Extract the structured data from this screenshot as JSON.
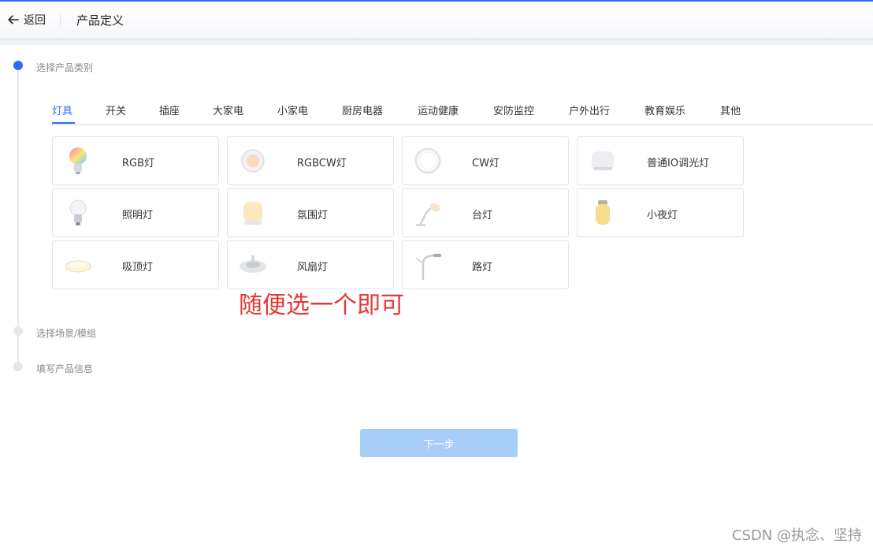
{
  "header": {
    "back_label": "返回",
    "title": "产品定义"
  },
  "steps": [
    {
      "label": "选择产品类别",
      "active": true
    },
    {
      "label": "选择场景/模组",
      "active": false
    },
    {
      "label": "填写产品信息",
      "active": false
    }
  ],
  "tabs": [
    {
      "label": "灯具",
      "active": true
    },
    {
      "label": "开关"
    },
    {
      "label": "插座"
    },
    {
      "label": "大家电"
    },
    {
      "label": "小家电"
    },
    {
      "label": "厨房电器"
    },
    {
      "label": "运动健康"
    },
    {
      "label": "安防监控"
    },
    {
      "label": "户外出行"
    },
    {
      "label": "教育娱乐"
    },
    {
      "label": "其他"
    }
  ],
  "products": [
    {
      "label": "RGB灯",
      "icon": "rgb-bulb-icon"
    },
    {
      "label": "RGBCW灯",
      "icon": "rgbcw-downlight-icon"
    },
    {
      "label": "CW灯",
      "icon": "cw-ring-light-icon"
    },
    {
      "label": "普通IO调光灯",
      "icon": "io-dimmer-light-icon"
    },
    {
      "label": "照明灯",
      "icon": "lighting-bulb-icon"
    },
    {
      "label": "氛围灯",
      "icon": "ambient-lamp-icon"
    },
    {
      "label": "台灯",
      "icon": "desk-lamp-icon"
    },
    {
      "label": "小夜灯",
      "icon": "night-light-icon"
    },
    {
      "label": "吸顶灯",
      "icon": "ceiling-light-icon"
    },
    {
      "label": "风扇灯",
      "icon": "fan-light-icon"
    },
    {
      "label": "路灯",
      "icon": "street-light-icon"
    }
  ],
  "annotation": "随便选一个即可",
  "next_button": "下一步",
  "watermark": "CSDN @执念、坚持",
  "colors": {
    "accent": "#2f6bf6",
    "button_disabled": "#a7cdf9",
    "annotation": "#e53935"
  }
}
